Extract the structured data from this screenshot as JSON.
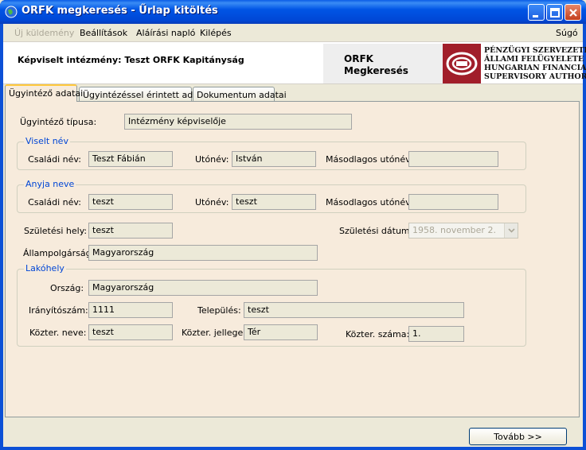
{
  "window": {
    "title": "ORFK megkeresés - Űrlap kitöltés"
  },
  "menu": {
    "items": [
      "Új küldemény",
      "Beállítások",
      "Aláírási napló",
      "Kilépés"
    ],
    "help": "Súgó"
  },
  "header": {
    "institution": "Képviselt intézmény: Teszt ORFK Kapitányság",
    "logo_title_1": "ORFK",
    "logo_title_2": "Megkeresés",
    "logo_lines": [
      "PÉNZÜGYI SZERVEZETEK",
      "ÁLLAMI FELÜGYELETE",
      "HUNGARIAN FINANCIAL",
      "SUPERVISORY AUTHORITY"
    ]
  },
  "tabs": [
    "Ügyintéző adatai",
    "Ügyintézéssel érintett adatai",
    "Dokumentum adatai"
  ],
  "form": {
    "type_label": "Ügyintéző típusa:",
    "type_value": "Intézmény képviselője",
    "viselt_nev": {
      "title": "Viselt név",
      "family_label": "Családi név:",
      "family_value": "Teszt Fábián",
      "given_label": "Utónév:",
      "given_value": "István",
      "second_label": "Másodlagos utónév:",
      "second_value": ""
    },
    "anyja_neve": {
      "title": "Anyja neve",
      "family_label": "Családi név:",
      "family_value": "teszt",
      "given_label": "Utónév:",
      "given_value": "teszt",
      "second_label": "Másodlagos utónév:",
      "second_value": ""
    },
    "birth_place_label": "Születési hely:",
    "birth_place_value": "teszt",
    "birth_date_label": "Születési dátum:",
    "birth_date_value": "1958.  november    2.",
    "citizenship_label": "Állampolgárság:",
    "citizenship_value": "Magyarország",
    "lakohely": {
      "title": "Lakóhely",
      "country_label": "Ország:",
      "country_value": "Magyarország",
      "zip_label": "Irányítószám:",
      "zip_value": "1111",
      "city_label": "Település:",
      "city_value": "teszt",
      "street_label": "Közter. neve:",
      "street_value": "teszt",
      "street_type_label": "Közter. jellege:",
      "street_type_value": "Tér",
      "number_label": "Közter. száma:",
      "number_value": "1."
    }
  },
  "next_button": "Tovább >>",
  "colors": {
    "titlebar": "#0055e5",
    "panel": "#f7ebdc",
    "group_title": "#0046d5",
    "logo": "#a11e2a"
  }
}
